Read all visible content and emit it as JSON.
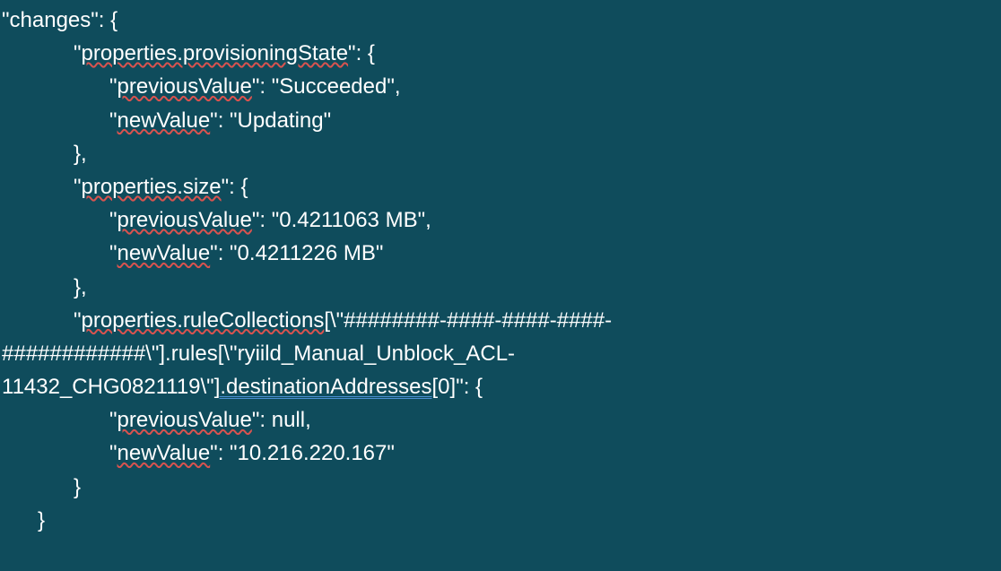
{
  "code": {
    "key_changes": "changes",
    "section1": {
      "key": "properties.provisioningState",
      "prev_label": "previousValue",
      "prev_value": "Succeeded",
      "new_label": "newValue",
      "new_value": "Updating"
    },
    "section2": {
      "key": "properties.size",
      "prev_label": "previousValue",
      "prev_value": "0.4211063 MB",
      "new_label": "newValue",
      "new_value": "0.4211226 MB"
    },
    "section3": {
      "key_part_a": "properties.ruleCollections",
      "key_part_b": "[\\\"########-####-####-####-",
      "key_line2": "############\\\"].rules[\\\"ryiild_Manual_Unblock_ACL-",
      "key_line3a": "11432_CHG0821119\\\"",
      "key_line3b": "].destinationAddresses",
      "key_line3c": "[0]",
      "prev_label": "previousValue",
      "prev_value": "null",
      "new_label": "newValue",
      "new_value": "10.216.220.167"
    }
  }
}
